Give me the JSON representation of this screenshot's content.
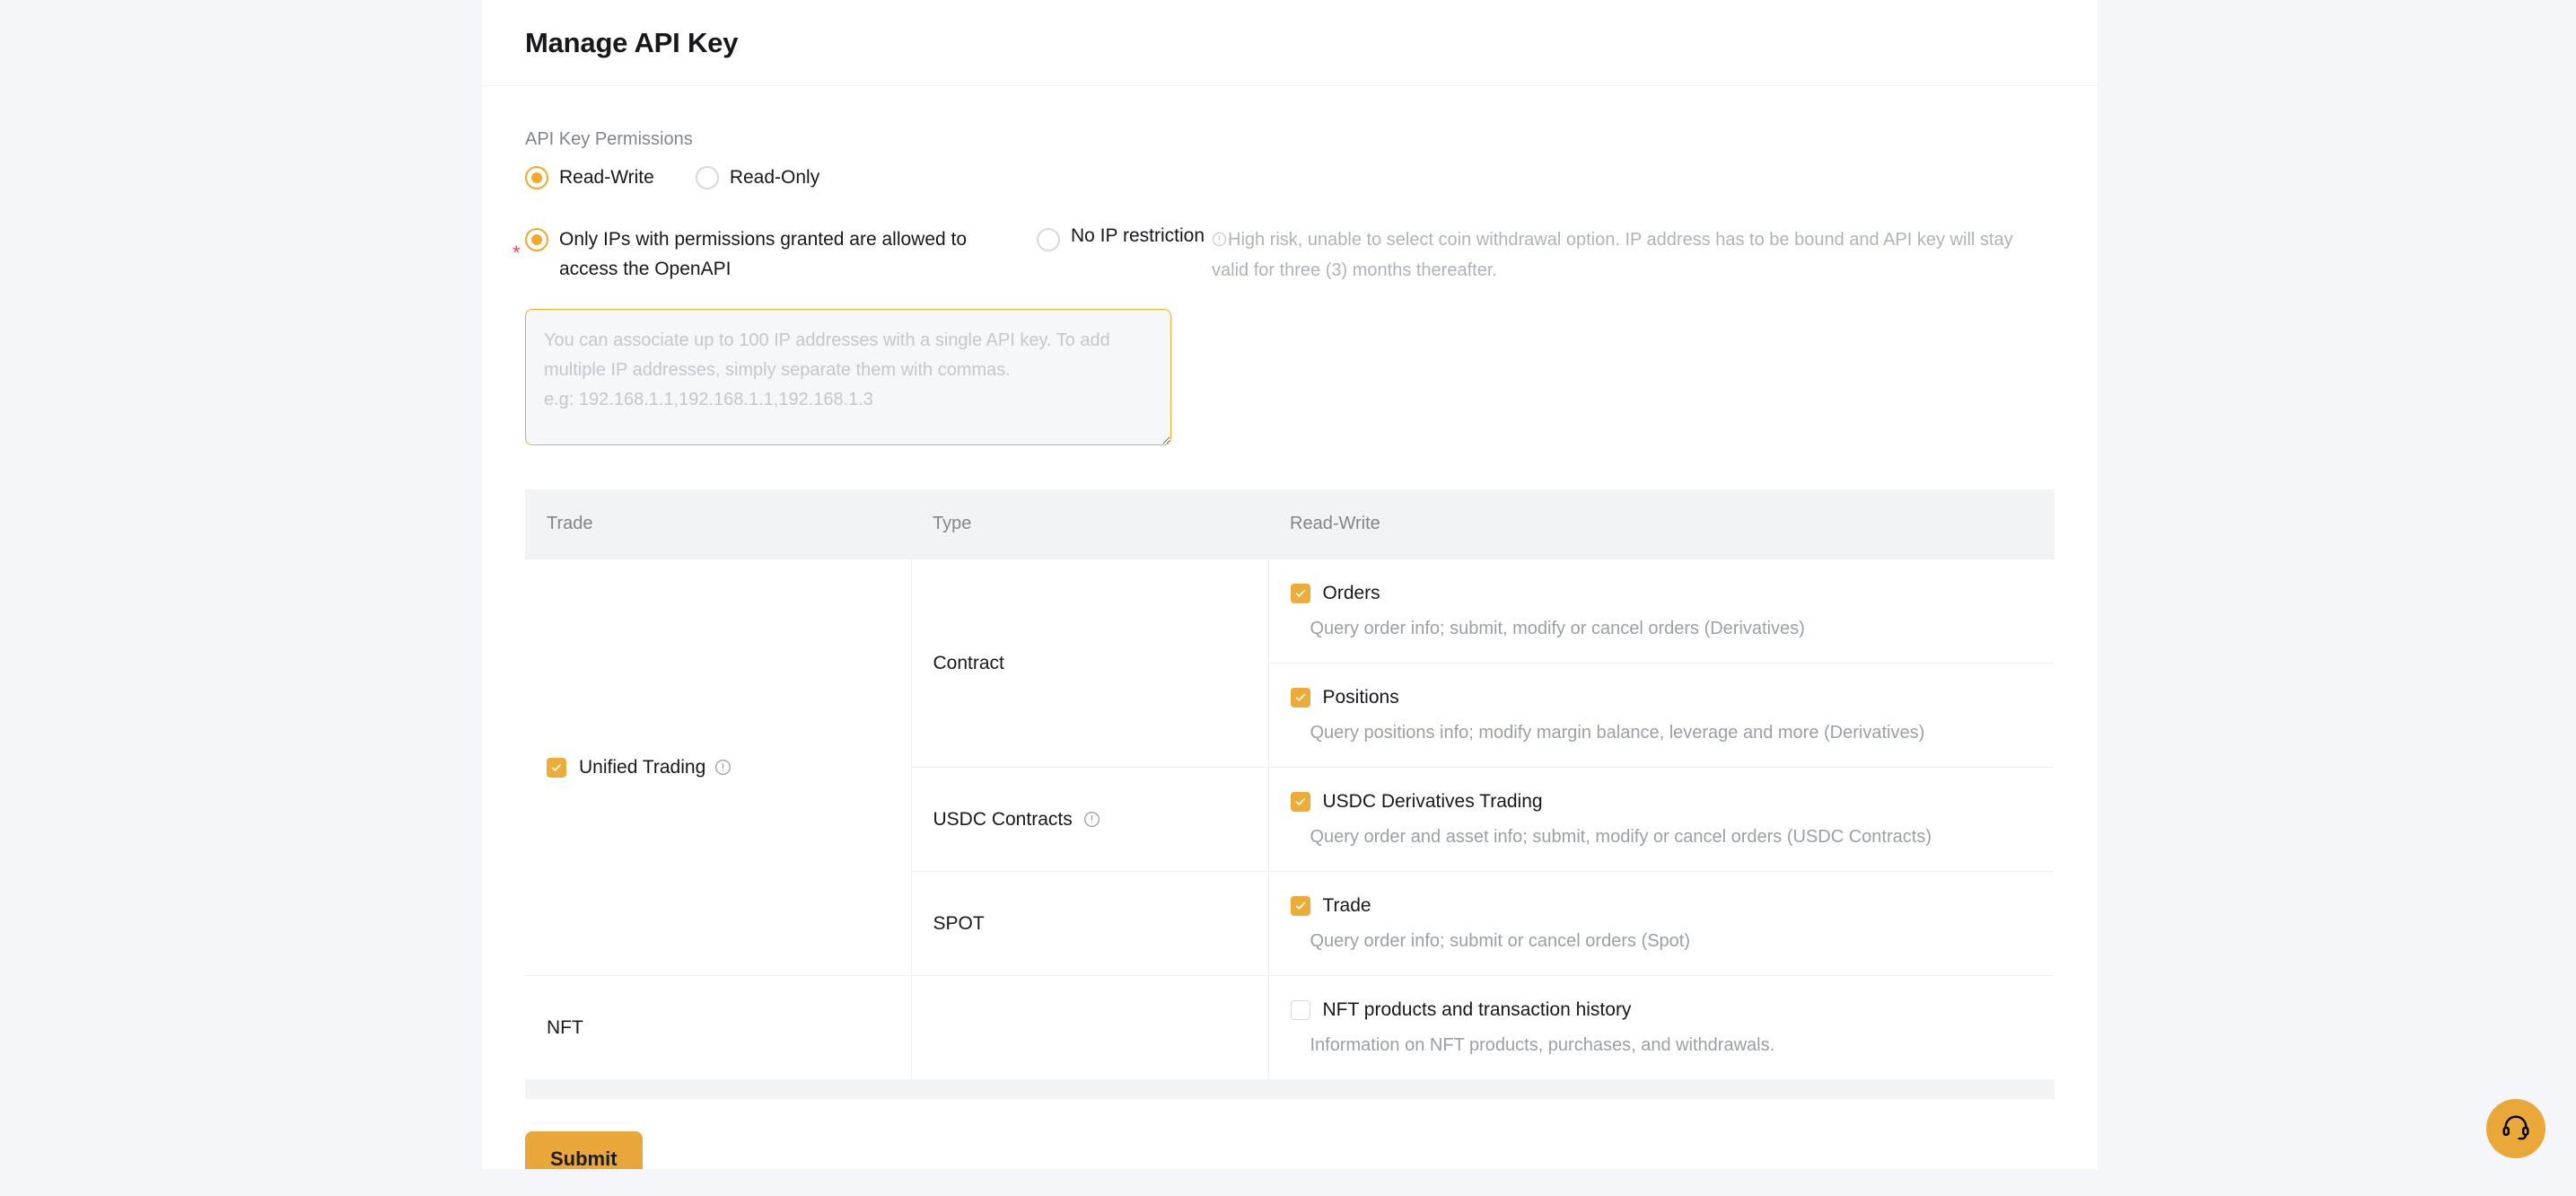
{
  "header": {
    "title": "Manage API Key"
  },
  "permissions": {
    "section_label": "API Key Permissions",
    "modes": [
      {
        "label": "Read-Write",
        "selected": true
      },
      {
        "label": "Read-Only",
        "selected": false
      }
    ],
    "ip_options": [
      {
        "label": "Only IPs with permissions granted are allowed to access the OpenAPI",
        "selected": true,
        "required": true
      },
      {
        "label": "No IP restriction",
        "selected": false,
        "required": false
      }
    ],
    "ip_warning": "High risk, unable to select coin withdrawal option. IP address has to be bound and API key will stay valid for three (3) months thereafter.",
    "ip_textarea": {
      "value": "",
      "placeholder": "You can associate up to 100 IP addresses with a single API key. To add multiple IP addresses, simply separate them with commas.\ne.g: 192.168.1.1,192.168.1.1,192.168.1.3"
    }
  },
  "table": {
    "columns": [
      "Trade",
      "Type",
      "Read-Write"
    ],
    "groups": [
      {
        "trade": "Unified Trading",
        "trade_checked": true,
        "trade_has_info": true,
        "types": [
          {
            "type": "Contract",
            "type_has_info": false,
            "items": [
              {
                "name": "Orders",
                "checked": true,
                "desc": "Query order info; submit, modify or cancel orders (Derivatives)"
              },
              {
                "name": "Positions",
                "checked": true,
                "desc": "Query positions info; modify margin balance, leverage and more (Derivatives)"
              }
            ]
          },
          {
            "type": "USDC Contracts",
            "type_has_info": true,
            "items": [
              {
                "name": "USDC Derivatives Trading",
                "checked": true,
                "desc": "Query order and asset info; submit, modify or cancel orders (USDC Contracts)"
              }
            ]
          },
          {
            "type": "SPOT",
            "type_has_info": false,
            "items": [
              {
                "name": "Trade",
                "checked": true,
                "desc": "Query order info; submit or cancel orders (Spot)"
              }
            ]
          }
        ]
      },
      {
        "trade": "NFT",
        "trade_checked": null,
        "trade_has_info": false,
        "types": [
          {
            "type": "",
            "type_has_info": false,
            "items": [
              {
                "name": "NFT products and transaction history",
                "checked": false,
                "desc": "Information on NFT products, purchases, and withdrawals."
              }
            ]
          }
        ]
      }
    ]
  },
  "footer": {
    "submit_label": "Submit"
  },
  "support": {
    "icon": "headset-icon"
  },
  "theme": {
    "accent": "#f0a92c",
    "submit_bg": "#e9a63a",
    "checkbox_on": "#edab38",
    "required_star": "#ef454a",
    "page_bg": "#f5f6fa",
    "panel_bg": "#ffffff",
    "table_header_bg": "#f2f3f5"
  }
}
